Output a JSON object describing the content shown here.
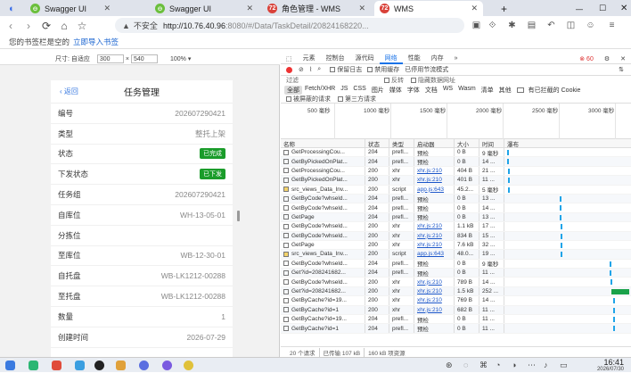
{
  "tabs": [
    {
      "title": "Swagger UI",
      "icon_color": "#6bbf3c",
      "icon_glyph": "⊖"
    },
    {
      "title": "Swagger UI",
      "icon_color": "#6bbf3c",
      "icon_glyph": "⊖"
    },
    {
      "title": "角色管理 - WMS",
      "icon_color": "#d9423a",
      "icon_glyph": "72"
    },
    {
      "title": "WMS",
      "icon_color": "#d9423a",
      "icon_glyph": "72"
    }
  ],
  "address": {
    "warning": "不安全",
    "host": "http://10.76.40.96",
    "path": ":8080/#/Data/TaskDetail/20824168220..."
  },
  "bookmarks": {
    "text": "您的书签栏是空的",
    "link": "立即导入书签"
  },
  "device_toolbar": {
    "size_label": "尺寸: 自适应",
    "width": "300",
    "height": "540",
    "zoom": "100%"
  },
  "phone": {
    "back": "返回",
    "title": "任务管理",
    "fields": [
      {
        "k": "编号",
        "v": "202607290421"
      },
      {
        "k": "类型",
        "v": "整托上架"
      },
      {
        "k": "状态",
        "v": "已完成",
        "badge": true
      },
      {
        "k": "下发状态",
        "v": "已下发",
        "badge": true
      },
      {
        "k": "任务组",
        "v": "202607290421"
      },
      {
        "k": "自库位",
        "v": "WH-13-05-01"
      },
      {
        "k": "分拣位",
        "v": ""
      },
      {
        "k": "至库位",
        "v": "WB-12-30-01"
      },
      {
        "k": "自托盘",
        "v": "WB-LK1212-00288"
      },
      {
        "k": "至托盘",
        "v": "WB-LK1212-00288"
      },
      {
        "k": "数量",
        "v": "1"
      },
      {
        "k": "创建时间",
        "v": "2026-07-29"
      }
    ]
  },
  "devtools": {
    "tabs": [
      "元素",
      "控制台",
      "源代码",
      "网络",
      "性能",
      "内存"
    ],
    "active_tab": "网络",
    "toolbar": [
      "保留日志",
      "禁用缓存",
      "已停用节流模式"
    ],
    "filter_placeholder": "过滤",
    "filter_options": [
      "反转",
      "隐藏数据网址"
    ],
    "types": [
      "全部",
      "Fetch/XHR",
      "JS",
      "CSS",
      "图片",
      "媒体",
      "字体",
      "文档",
      "WS",
      "Wasm",
      "清单",
      "其他"
    ],
    "blocked_cookies": "有已拦截的 Cookie",
    "blocked": [
      "被屏蔽的请求",
      "第三方请求"
    ],
    "timeline": [
      "500 毫秒",
      "1000 毫秒",
      "1500 毫秒",
      "2000 毫秒",
      "2500 毫秒",
      "3000 毫秒"
    ],
    "columns": [
      "名称",
      "状态",
      "类型",
      "启动器",
      "大小",
      "时间",
      "瀑布"
    ],
    "rows": [
      [
        "GetProcessingCou...",
        "204",
        "prefl...",
        "预检",
        "0 B",
        "9 毫秒"
      ],
      [
        "GetByPickedOnPlat...",
        "204",
        "prefl...",
        "预检",
        "0 B",
        "14 ..."
      ],
      [
        "GetProcessingCou...",
        "200",
        "xhr",
        "xhr.js:210",
        "404 B",
        "21 ..."
      ],
      [
        "GetByPickedOnPlat...",
        "200",
        "xhr",
        "xhr.js:210",
        "401 B",
        "11 ..."
      ],
      [
        "src_views_Data_Inv...",
        "200",
        "script",
        "app.js:643",
        "45.2...",
        "5 毫秒"
      ],
      [
        "GetByCode?whseld...",
        "204",
        "prefl...",
        "预检",
        "0 B",
        "13 ..."
      ],
      [
        "GetByCode?whseld...",
        "204",
        "prefl...",
        "预检",
        "0 B",
        "14 ..."
      ],
      [
        "GetPage",
        "204",
        "prefl...",
        "预检",
        "0 B",
        "13 ..."
      ],
      [
        "GetByCode?whseld...",
        "200",
        "xhr",
        "xhr.js:210",
        "1.1 kB",
        "17 ..."
      ],
      [
        "GetByCode?whseld...",
        "200",
        "xhr",
        "xhr.js:210",
        "834 B",
        "15 ..."
      ],
      [
        "GetPage",
        "200",
        "xhr",
        "xhr.js:210",
        "7.6 kB",
        "32 ..."
      ],
      [
        "src_views_Data_Inv...",
        "200",
        "script",
        "app.js:643",
        "48.0...",
        "19 ..."
      ],
      [
        "GetByCode?whseld...",
        "204",
        "prefl...",
        "预检",
        "0 B",
        "9 毫秒"
      ],
      [
        "Get?id=208241682...",
        "204",
        "prefl...",
        "预检",
        "0 B",
        "11 ..."
      ],
      [
        "GetByCode?whseld...",
        "200",
        "xhr",
        "xhr.js:210",
        "789 B",
        "14 ..."
      ],
      [
        "Get?id=208241682...",
        "200",
        "xhr",
        "xhr.js:210",
        "1.5 kB",
        "252 ..."
      ],
      [
        "GetByCache?id=19...",
        "200",
        "xhr",
        "xhr.js:210",
        "769 B",
        "14 ..."
      ],
      [
        "GetByCache?id=1",
        "200",
        "xhr",
        "xhr.js:210",
        "682 B",
        "11 ..."
      ],
      [
        "GetByCache?id=19...",
        "204",
        "prefl...",
        "预检",
        "0 B",
        "11 ..."
      ],
      [
        "GetByCache?id=1",
        "204",
        "prefl...",
        "预检",
        "0 B",
        "11 ..."
      ]
    ],
    "status": [
      "20 个请求",
      "已传输 107 kB",
      "160 kB 项资源"
    ]
  },
  "taskbar": {
    "time": "16:41",
    "date": "2026/07/30"
  }
}
